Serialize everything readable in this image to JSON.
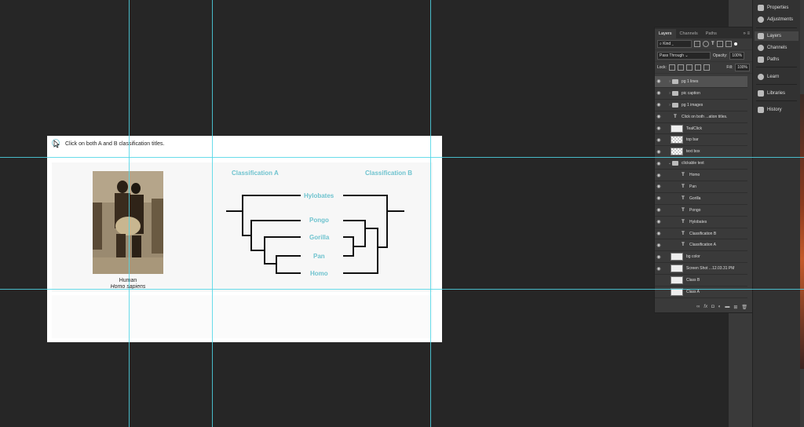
{
  "canvas": {
    "instruction": "Click on both A and B classification titles.",
    "photo_caption_common": "Human",
    "photo_caption_latin": "Homo sapiens",
    "classification_a": "Classification A",
    "classification_b": "Classification B",
    "taxa": [
      "Hylobates",
      "Pongo",
      "Gorilla",
      "Pan",
      "Homo"
    ]
  },
  "colors": {
    "teal": "#6fc3cf",
    "guide": "#4fd6e6"
  },
  "panel": {
    "tabs": [
      "Layers",
      "Channels",
      "Paths"
    ],
    "active_tab": "Layers",
    "filter_kind": "Kind",
    "blend_mode": "Pass Through",
    "opacity_label": "Opacity:",
    "opacity_value": "100%",
    "lock_label": "Lock:",
    "fill_label": "Fill:",
    "fill_value": "100%",
    "layers": [
      {
        "name": "pg 1 lines",
        "kind": "group",
        "indent": 0,
        "selected": true
      },
      {
        "name": "pic caption",
        "kind": "group",
        "indent": 0
      },
      {
        "name": "pg 1 images",
        "kind": "group",
        "indent": 0
      },
      {
        "name": "Click on both ...ation titles.",
        "kind": "text",
        "indent": 0
      },
      {
        "name": "TealClick",
        "kind": "smart",
        "indent": 0
      },
      {
        "name": "top bar",
        "kind": "checker",
        "indent": 0
      },
      {
        "name": "text box",
        "kind": "checker",
        "indent": 0
      },
      {
        "name": "clickable text",
        "kind": "group-open",
        "indent": 0
      },
      {
        "name": "Homo",
        "kind": "text",
        "indent": 1
      },
      {
        "name": "Pan",
        "kind": "text",
        "indent": 1
      },
      {
        "name": "Gorilla",
        "kind": "text",
        "indent": 1
      },
      {
        "name": "Pongo",
        "kind": "text",
        "indent": 1
      },
      {
        "name": "Hylobates",
        "kind": "text",
        "indent": 1
      },
      {
        "name": "Classification B",
        "kind": "text",
        "indent": 1
      },
      {
        "name": "Classification A",
        "kind": "text",
        "indent": 1
      },
      {
        "name": "bg color",
        "kind": "white",
        "indent": 0
      },
      {
        "name": "Screen Shot ...12.03.31 PM",
        "kind": "smart",
        "indent": 0
      },
      {
        "name": "Class B",
        "kind": "smart",
        "indent": 0,
        "hidden_eye": true
      },
      {
        "name": "Class A",
        "kind": "smart",
        "indent": 0,
        "hidden_eye": true
      }
    ]
  },
  "strip": {
    "group1": [
      "Properties",
      "Adjustments"
    ],
    "group2": [
      "Layers",
      "Channels",
      "Paths"
    ],
    "group3": [
      "Learn"
    ],
    "group4": [
      "Libraries"
    ],
    "group5": [
      "History"
    ]
  }
}
